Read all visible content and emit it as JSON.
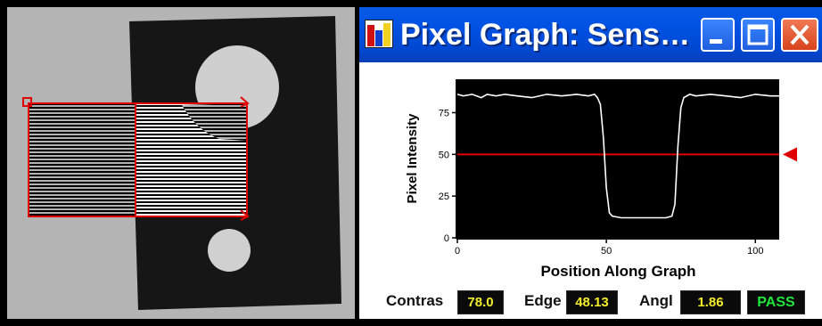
{
  "window": {
    "title": "Pixel Graph: Sens…",
    "icon": "chart-app-icon",
    "controls": [
      "minimize-icon",
      "maximize-icon",
      "close-icon"
    ]
  },
  "colors": {
    "title_bar": "#0052e4",
    "plot_background": "#000000",
    "trace": "#ffffff",
    "threshold": "#e00000",
    "value_text": "#f2ee2a",
    "pass_text": "#1ee63c",
    "roi": "#e00000"
  },
  "chart_data": {
    "type": "line",
    "xlabel": "Position Along Graph",
    "ylabel": "Pixel Intensity",
    "xlim": [
      0,
      108
    ],
    "ylim": [
      0,
      95
    ],
    "xticks": [
      0,
      50,
      100
    ],
    "yticks": [
      0,
      25,
      50,
      75
    ],
    "threshold": 50,
    "grid": false,
    "series": [
      {
        "x": [
          0,
          2,
          5,
          8,
          10,
          13,
          16,
          20,
          25,
          30,
          35,
          40,
          44,
          46,
          47,
          48,
          49,
          50,
          51,
          52,
          55,
          60,
          65,
          70,
          72,
          73,
          74,
          75,
          76,
          78,
          80,
          85,
          90,
          95,
          100,
          105,
          108
        ],
        "y": [
          86,
          85,
          86,
          84,
          86,
          85,
          86,
          85,
          84,
          86,
          85,
          86,
          85,
          86,
          84,
          80,
          60,
          30,
          15,
          13,
          12,
          12,
          12,
          12,
          13,
          20,
          55,
          78,
          84,
          86,
          85,
          86,
          85,
          84,
          86,
          85,
          85
        ]
      }
    ]
  },
  "status": {
    "contrast_label": "Contras",
    "contrast_value": "78.0",
    "edge_label": "Edge",
    "edge_value": "48.13",
    "angle_label": "Angl",
    "angle_value": "1.86",
    "result": "PASS"
  }
}
